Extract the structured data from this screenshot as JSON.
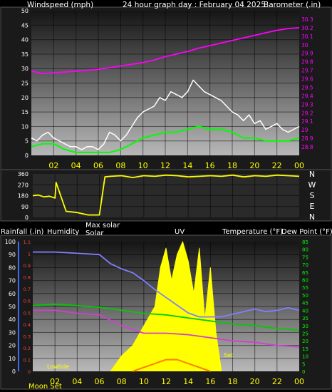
{
  "header": {
    "windspeed_label": "Windspeed (mph)",
    "title": "24 hour graph day : February 04 2025",
    "barometer_label": "Barometer (.in)"
  },
  "lower_header": {
    "rainfall": "Rainfall (.in)",
    "humidity": "Humidity",
    "max_solar": "Max solar",
    "solar": "Solar",
    "uv": "UV",
    "temperature": "Temperature (°F)",
    "dewpoint": "Dew Point (°F)"
  },
  "compass": {
    "n1": "N",
    "w": "W",
    "s": "S",
    "e": "E",
    "n2": "N"
  },
  "annotations": {
    "low_tide": "Lowtide",
    "set": "Set",
    "moon": "Moon Set"
  },
  "colors": {
    "wind": "#ffffff",
    "wind_avg": "#00ff00",
    "barometer": "#ff00ff",
    "direction": "#ffff00",
    "rain": "#3a6bff",
    "humidity": "#7f7fff",
    "temperature": "#d040d0",
    "dewpoint": "#00cc00",
    "solar": "#ffff00",
    "maxsolar": "#aaaaaa",
    "uv": "#ff8000",
    "tick_text": "#ffff00"
  },
  "chart_data": [
    {
      "type": "line",
      "title": "24 hour graph day : February 04 2025",
      "x_ticks": [
        "02",
        "04",
        "06",
        "08",
        "10",
        "12",
        "14",
        "16",
        "18",
        "20",
        "22",
        "00"
      ],
      "xrange_hours": [
        0,
        24
      ],
      "ylabel_left": "Windspeed (mph)",
      "ylim_left": [
        0,
        50
      ],
      "yticks_left": [
        "0",
        "5",
        "10",
        "15",
        "20",
        "25",
        "30",
        "35",
        "40",
        "45",
        "50"
      ],
      "ylabel_right": "Barometer (.in)",
      "ylim_right": [
        28.7,
        30.4
      ],
      "yticks_right": [
        "28.8",
        "28.9",
        "29",
        "29.1",
        "29.2",
        "29.3",
        "29.4",
        "29.5",
        "29.6",
        "29.7",
        "29.8",
        "29.9",
        "30",
        "30.1",
        "30.2",
        "30.3"
      ],
      "grid": true,
      "series": [
        {
          "name": "Windspeed (mph)",
          "color": "#ffffff",
          "hours": [
            0,
            0.5,
            1,
            1.5,
            2,
            2.5,
            3,
            3.5,
            4,
            4.5,
            5,
            5.5,
            6,
            6.5,
            7,
            7.5,
            8,
            8.5,
            9,
            9.5,
            10,
            10.5,
            11,
            11.5,
            12,
            12.5,
            13,
            13.5,
            14,
            14.5,
            15,
            15.5,
            16,
            16.5,
            17,
            17.5,
            18,
            18.5,
            19,
            19.5,
            20,
            20.5,
            21,
            21.5,
            22,
            22.5,
            23,
            23.5,
            24
          ],
          "values": [
            6,
            5,
            7,
            8,
            6,
            5,
            4,
            3,
            3,
            2,
            3,
            3,
            2,
            4,
            8,
            7,
            5,
            7,
            10,
            13,
            15,
            16,
            17,
            20,
            19,
            22,
            21,
            20,
            22,
            26,
            24,
            22,
            21,
            20,
            19,
            17,
            15,
            14,
            12,
            14,
            11,
            12,
            9,
            10,
            11,
            9,
            8,
            9,
            10
          ]
        },
        {
          "name": "Wind average",
          "color": "#00ff00",
          "hours": [
            0,
            1,
            2,
            3,
            4,
            5,
            6,
            7,
            8,
            9,
            10,
            11,
            12,
            13,
            14,
            15,
            16,
            17,
            18,
            19,
            20,
            21,
            22,
            23,
            24
          ],
          "values": [
            3,
            4,
            4,
            2,
            1,
            1,
            1,
            1,
            2,
            4,
            6,
            7,
            8,
            8,
            9,
            10,
            9,
            9,
            8,
            6,
            6,
            5,
            5,
            5,
            6
          ]
        },
        {
          "name": "Barometer (.in)",
          "color": "#ff00ff",
          "axis": "right",
          "hours": [
            0,
            1,
            2,
            3,
            4,
            5,
            6,
            7,
            8,
            9,
            10,
            11,
            12,
            13,
            14,
            15,
            16,
            17,
            18,
            19,
            20,
            21,
            22,
            23,
            24
          ],
          "values": [
            29.69,
            29.66,
            29.67,
            29.68,
            29.69,
            29.7,
            29.71,
            29.73,
            29.75,
            29.77,
            29.79,
            29.82,
            29.86,
            29.89,
            29.92,
            29.96,
            29.99,
            30.02,
            30.05,
            30.08,
            30.11,
            30.14,
            30.17,
            30.19,
            30.2
          ]
        }
      ]
    },
    {
      "type": "line",
      "xrange_hours": [
        0,
        24
      ],
      "ylim": [
        0,
        360
      ],
      "yticks": [
        "0",
        "90",
        "180",
        "270",
        "360"
      ],
      "grid": true,
      "series": [
        {
          "name": "Wind direction",
          "color": "#ffff00",
          "hours": [
            0,
            0.5,
            1,
            1.5,
            2,
            2.1,
            3,
            4,
            5,
            5.5,
            6,
            6.5,
            7,
            8,
            9,
            10,
            11,
            12,
            13,
            14,
            15,
            16,
            17,
            18,
            19,
            20,
            21,
            22,
            23,
            24
          ],
          "values": [
            180,
            185,
            170,
            175,
            160,
            290,
            50,
            40,
            20,
            20,
            20,
            335,
            340,
            345,
            330,
            345,
            340,
            350,
            345,
            335,
            340,
            345,
            340,
            350,
            335,
            345,
            340,
            350,
            345,
            340
          ]
        }
      ]
    },
    {
      "type": "line",
      "xrange_hours": [
        0,
        24
      ],
      "x_ticks": [
        "02",
        "04",
        "06",
        "08",
        "10",
        "12",
        "14",
        "16",
        "18",
        "20",
        "22",
        "00"
      ],
      "ylabel_left": "Humidity",
      "ylim_left": [
        0,
        100
      ],
      "yticks_left": [
        "0",
        "10",
        "20",
        "30",
        "40",
        "50",
        "60",
        "70",
        "80",
        "90",
        "100"
      ],
      "ylabel_rain": "Rainfall (.in)",
      "ylim_rain": [
        0,
        1.1
      ],
      "yticks_rain": [
        "0",
        "0.1",
        "0.2",
        "0.3",
        "0.4",
        "0.5",
        "0.6",
        "0.7",
        "0.8",
        "0.9",
        "1",
        "1.1"
      ],
      "ylabel_right": "Temperature (°F) Dew Point (°F)",
      "ylim_right": [
        0,
        85
      ],
      "yticks_right": [
        "0",
        "5",
        "10",
        "15",
        "20",
        "25",
        "30",
        "35",
        "40",
        "45",
        "50",
        "55",
        "60",
        "65",
        "70",
        "75",
        "80",
        "85"
      ],
      "grid": true,
      "series": [
        {
          "name": "Humidity",
          "color": "#7f7fff",
          "hours": [
            0,
            2,
            4,
            6,
            7,
            8,
            9,
            10,
            11,
            12,
            13,
            14,
            15,
            16,
            17,
            18,
            19,
            20,
            21,
            22,
            23,
            24
          ],
          "values": [
            92,
            92,
            91,
            90,
            83,
            79,
            76,
            70,
            63,
            57,
            51,
            45,
            42,
            42,
            42,
            44,
            46,
            48,
            46,
            47,
            49,
            47
          ]
        },
        {
          "name": "Temperature (°F)",
          "color": "#d040d0",
          "hours": [
            0,
            2,
            4,
            6,
            8,
            10,
            12,
            14,
            16,
            18,
            20,
            22,
            24
          ],
          "values": [
            40,
            40,
            38,
            37,
            30,
            25,
            25,
            24,
            22,
            20,
            19,
            17,
            16
          ]
        },
        {
          "name": "Dew Point (°F)",
          "color": "#00cc00",
          "hours": [
            0,
            2,
            4,
            6,
            8,
            10,
            12,
            14,
            16,
            18,
            20,
            22,
            24
          ],
          "values": [
            43,
            44,
            43,
            42,
            40,
            38,
            37,
            35,
            33,
            31,
            30,
            28,
            27
          ]
        },
        {
          "name": "Solar",
          "color": "#ffff00",
          "hours": [
            7,
            8,
            9,
            10,
            11,
            11.5,
            12,
            12.5,
            13,
            13.5,
            14,
            14.5,
            15,
            15.5,
            16,
            16.5,
            17
          ],
          "values": [
            0,
            12,
            20,
            35,
            50,
            80,
            95,
            70,
            90,
            100,
            85,
            60,
            95,
            40,
            80,
            30,
            0
          ]
        },
        {
          "name": "Max solar",
          "color": "#aaaaaa",
          "hours": [
            7,
            8,
            9,
            10,
            11,
            12,
            13,
            14,
            15,
            16,
            17
          ],
          "values": [
            0,
            10,
            20,
            28,
            33,
            36,
            36,
            33,
            26,
            14,
            0
          ]
        },
        {
          "name": "UV",
          "color": "#ff8000",
          "hours": [
            9,
            10,
            11,
            12,
            13,
            14,
            15,
            16
          ],
          "values": [
            0,
            1,
            2,
            3,
            3,
            2,
            1,
            0
          ]
        }
      ]
    }
  ]
}
